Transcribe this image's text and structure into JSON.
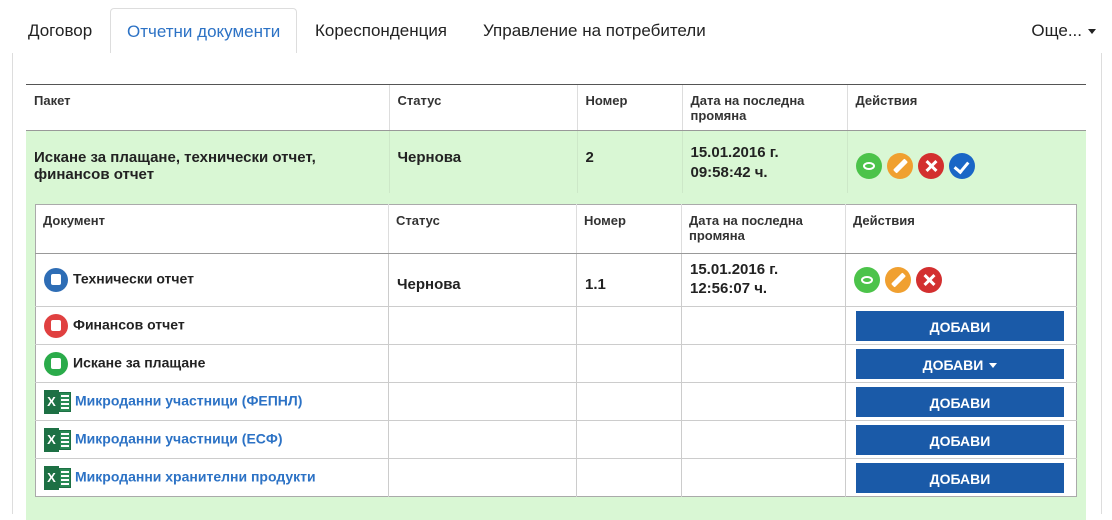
{
  "tabs": [
    {
      "label": "Договор"
    },
    {
      "label": "Отчетни документи"
    },
    {
      "label": "Кореспонденция"
    },
    {
      "label": "Управление на потребители"
    }
  ],
  "more_label": "Още...",
  "outer_table": {
    "headers": [
      "Пакет",
      "Статус",
      "Номер",
      "Дата на последна промяна",
      "Действия"
    ],
    "row": {
      "package": "Искане за плащане, технически отчет, финансов отчет",
      "status": "Чернова",
      "number": "2",
      "date": "15.01.2016 г.",
      "time": "09:58:42 ч."
    }
  },
  "inner_table": {
    "headers": [
      "Документ",
      "Статус",
      "Номер",
      "Дата на последна промяна",
      "Действия"
    ],
    "rows": [
      {
        "name": "Технически отчет",
        "status": "Чернова",
        "number": "1.1",
        "date": "15.01.2016 г.",
        "time": "12:56:07 ч."
      },
      {
        "name": "Финансов отчет",
        "button": "ДОБАВИ"
      },
      {
        "name": "Искане за плащане",
        "button": "ДОБАВИ"
      },
      {
        "name": "Микроданни участници (ФЕПНЛ)",
        "button": "ДОБАВИ"
      },
      {
        "name": "Микроданни участници (ЕСФ)",
        "button": "ДОБАВИ"
      },
      {
        "name": "Микроданни хранителни продукти",
        "button": "ДОБАВИ"
      }
    ]
  },
  "colors": {
    "accent": "#2c72c5",
    "row_highlight": "#d9f7d4",
    "button": "#1a5aa8"
  },
  "icons": [
    "eye-icon",
    "pencil-icon",
    "delete-icon",
    "check-icon",
    "excel-icon"
  ]
}
